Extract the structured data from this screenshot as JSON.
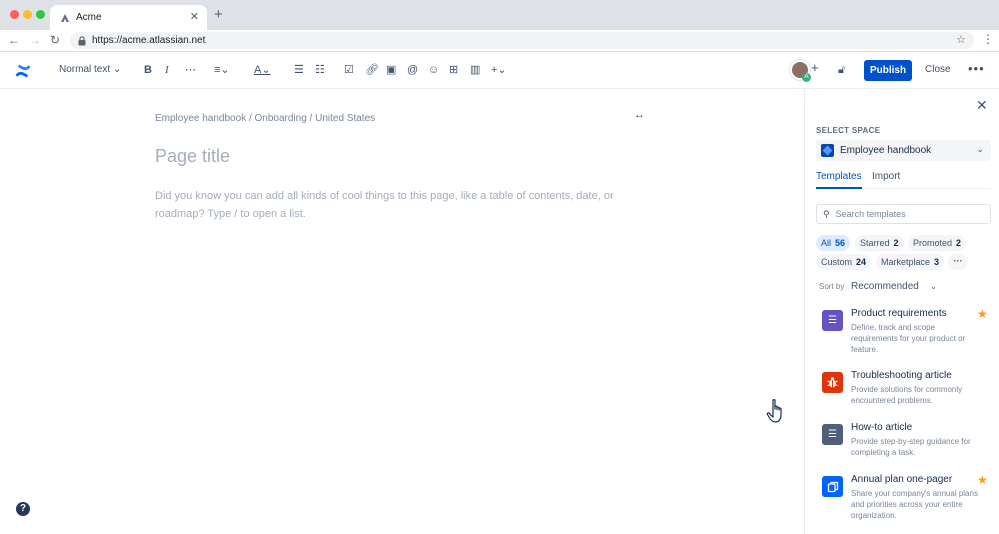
{
  "browser": {
    "tab_title": "Acme",
    "new_tab": "+",
    "url": "https://acme.atlassian.net"
  },
  "toolbar": {
    "text_style": "Normal text",
    "bold": "B",
    "italic": "I",
    "more_format": "⋯",
    "publish_label": "Publish",
    "close_label": "Close"
  },
  "editor": {
    "breadcrumb": "Employee handbook  /  Onboarding / United States",
    "title_placeholder": "Page title",
    "body_placeholder": "Did you know you can add all kinds of cool things to this page, like a table of contents, date, or roadmap? Type / to open a list."
  },
  "panel": {
    "select_space_label": "SELECT SPACE",
    "space_name": "Employee handbook",
    "tabs": [
      {
        "label": "Templates",
        "active": true
      },
      {
        "label": "Import",
        "active": false
      }
    ],
    "search_placeholder": "Search templates",
    "filters": [
      {
        "label": "All",
        "count": "56",
        "active": true
      },
      {
        "label": "Starred",
        "count": "2",
        "active": false
      },
      {
        "label": "Promoted",
        "count": "2",
        "active": false
      },
      {
        "label": "Custom",
        "count": "24",
        "active": false
      },
      {
        "label": "Marketplace",
        "count": "3",
        "active": false
      }
    ],
    "sort_label": "Sort by",
    "sort_value": "Recommended",
    "templates": [
      {
        "title": "Product requirements",
        "description": "Define, track and scope requirements for your product or feature.",
        "icon": "list-icon",
        "color": "#6554c0",
        "starred": true
      },
      {
        "title": "Troubleshooting article",
        "description": "Provide solutions for commonly encountered problems.",
        "icon": "bug-icon",
        "color": "#de350b",
        "starred": false
      },
      {
        "title": "How-to article",
        "description": "Provide step-by-step guidance for completing a task.",
        "icon": "list-icon",
        "color": "#505f79",
        "starred": false
      },
      {
        "title": "Annual plan one-pager",
        "description": "Share your company's annual plans and priorities across your entire organization.",
        "icon": "document-icon",
        "color": "#0065ff",
        "starred": true
      }
    ]
  },
  "colors": {
    "brand_blue": "#0052cc",
    "star_orange": "#ff991f"
  }
}
